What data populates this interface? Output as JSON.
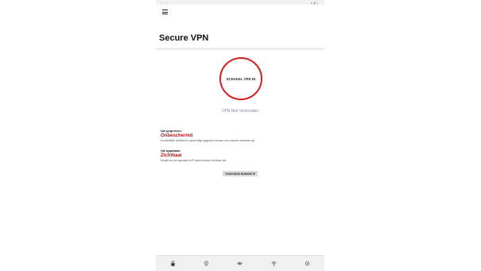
{
  "app": {
    "title": "Secure VPN"
  },
  "connect": {
    "button_label": "SCHAKEL VPN IN",
    "ring_color": "#d81e1e"
  },
  "status": {
    "text": "VPN Niet Verbonden"
  },
  "data_section": {
    "label": "Uw gegevens:",
    "value": "Onbeschermd",
    "description": "Uw identiteit, activiteit en persoonlijke gegevens kunnen voor anderen zichtbaar zijn."
  },
  "device_section": {
    "label": "Uw apparaat:",
    "value": "Zichtbaar",
    "description": "Details van uw apparaat en IP-adres kunnen zichtbaar zijn."
  },
  "ip_button": {
    "label": "TOON MIJN HUIDIGE IP"
  },
  "bottom_nav": [
    {
      "name": "vpn-tab",
      "icon": "lock-icon"
    },
    {
      "name": "location-tab",
      "icon": "location-pin-icon"
    },
    {
      "name": "privacy-tab",
      "icon": "eye-icon"
    },
    {
      "name": "wifi-tab",
      "icon": "wifi-shield-icon"
    },
    {
      "name": "settings-tab",
      "icon": "gear-icon"
    }
  ],
  "colors": {
    "accent": "#c81414",
    "status_text": "#8a8aa8"
  }
}
